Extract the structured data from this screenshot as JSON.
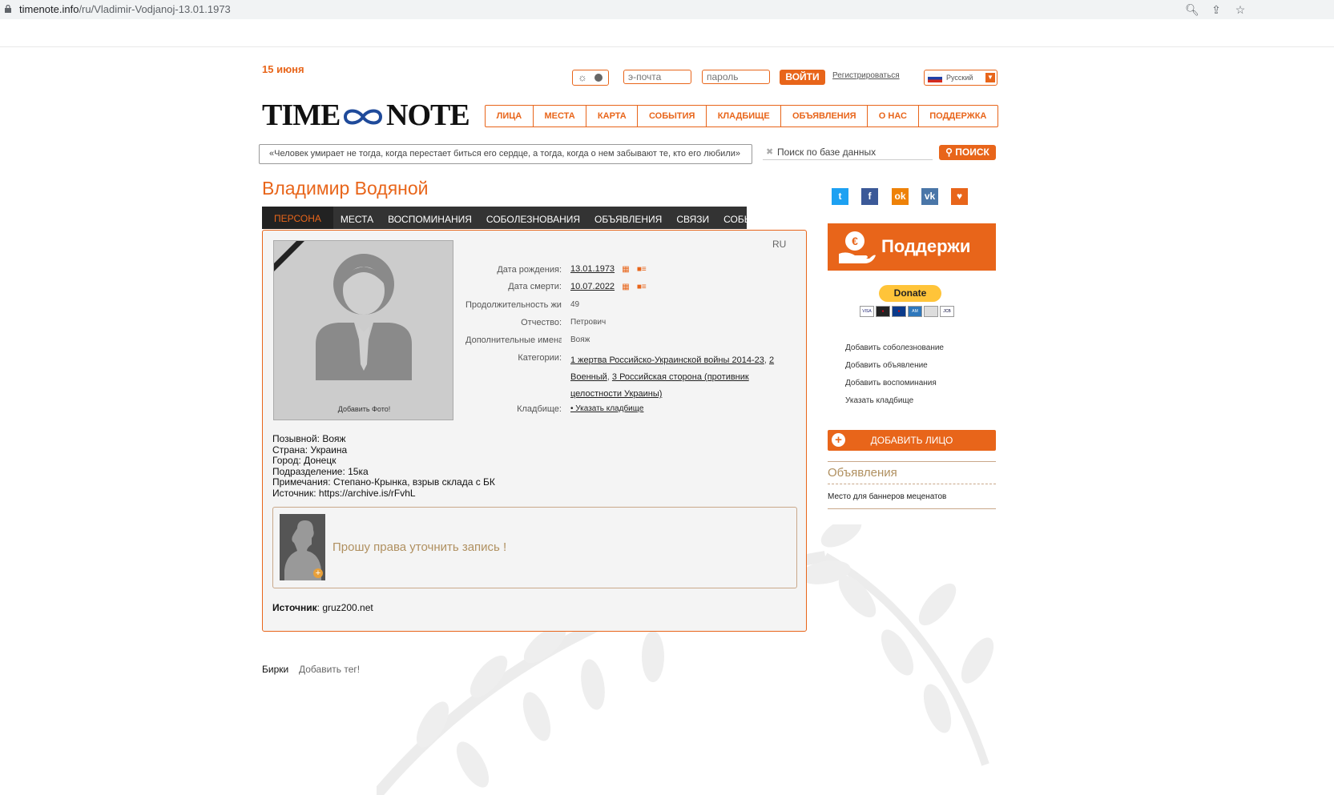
{
  "browser": {
    "url_host": "timenote.info",
    "url_path": "/ru/Vladimir-Vodjanoj-13.01.1973"
  },
  "header": {
    "date": "15 июня",
    "email_placeholder": "э-почта",
    "password_placeholder": "пароль",
    "login_label": "ВОЙТИ",
    "register_label": "Регистрироваться",
    "language": "Русский",
    "logo_left": "TIME",
    "logo_right": "NOTE"
  },
  "nav": {
    "items": [
      "ЛИЦА",
      "МЕСТА",
      "КАРТА",
      "СОБЫТИЯ",
      "КЛАДБИЩЕ",
      "ОБЪЯВЛЕНИЯ",
      "О НАС",
      "ПОДДЕРЖКА"
    ]
  },
  "quote": "«Человек умирает не тогда, когда перестает биться его сердце, а тогда, когда о нем забывают те, кто его любили»",
  "search": {
    "placeholder": "Поиск по базе данных",
    "button_label": "ПОИСК"
  },
  "person": {
    "name": "Владимир Водяной",
    "tabs": [
      "ПЕРСОНА",
      "МЕСТА",
      "ВОСПОМИНАНИЯ",
      "СОБОЛЕЗНОВАНИЯ",
      "ОБЪЯВЛЕНИЯ",
      "СВЯЗИ",
      "СОБЫТИЯ"
    ],
    "lang_code": "RU",
    "add_photo": "Добавить Фото!",
    "fields": {
      "birth_label": "Дата рождения:",
      "birth_value": "13.01.1973",
      "death_label": "Дата смерти:",
      "death_value": "10.07.2022",
      "duration_label": "Продолжительность жизни:",
      "duration_value": "49",
      "patronymic_label": "Отчество:",
      "patronymic_value": "Петрович",
      "extra_names_label": "Дополнительные имена:",
      "extra_names_value": "Вояж",
      "categories_label": "Категории:",
      "cat1": "1 жертва Российско-Украинской войны 2014-23",
      "cat2": "2 Военный",
      "cat3a": "3 Российская сторона (противник",
      "cat3b": "целостности Украины)",
      "cemetery_label": "Кладбище:",
      "cemetery_value": "• Указать кладбище"
    },
    "bio": [
      "Позывной: Вояж",
      "Страна: Украина",
      "Город: Донецк",
      "Подразделение: 15ка",
      "Примечания: Степано-Крынка, взрыв склада с БК",
      "Источник: https://archive.is/rFvhL"
    ],
    "notice": "Прошу права уточнить запись !",
    "source_label": "Источник",
    "source_value": ": gruz200.net",
    "tags_label": "Бирки",
    "add_tag": "Добавить тег!"
  },
  "sidebar": {
    "support_label": "Поддержи",
    "donate_label": "Donate",
    "links": [
      "Добавить соболезнование",
      "Добавить объявление",
      "Добавить воспоминания",
      "Указать кладбище"
    ],
    "add_face_label": "ДОБАВИТЬ ЛИЦО",
    "ads_title": "Объявления",
    "ads_text": "Место для баннеров меценатов"
  },
  "colors": {
    "accent": "#e8651a",
    "tab_bar": "#333333"
  }
}
